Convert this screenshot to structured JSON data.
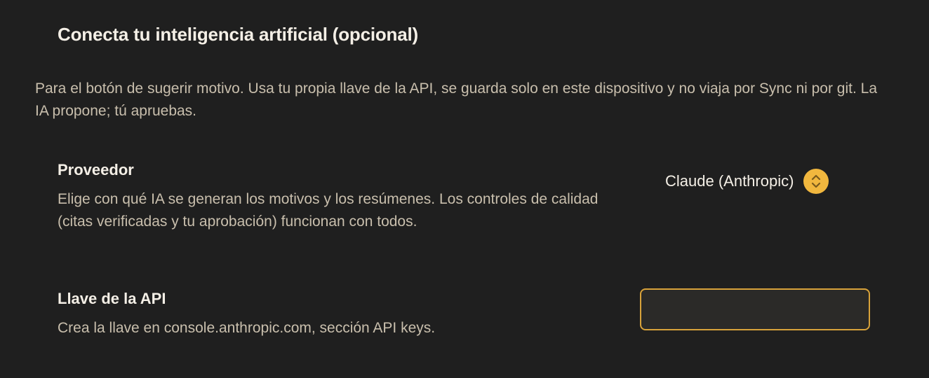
{
  "section": {
    "title": "Conecta tu inteligencia artificial (opcional)",
    "intro": "Para el botón de sugerir motivo. Usa tu propia llave de la API, se guarda solo en este dispositivo y no viaja por Sync ni por git. La IA propone; tú apruebas."
  },
  "provider": {
    "title": "Proveedor",
    "description": "Elige con qué IA se generan los motivos y los resúmenes. Los controles de calidad (citas verificadas y tu aprobación) funcionan con todos.",
    "selected": "Claude (Anthropic)",
    "icon": "chevron-up-down-icon"
  },
  "api_key": {
    "title": "Llave de la API",
    "description": "Crea la llave en console.anthropic.com, sección API keys.",
    "value": ""
  },
  "colors": {
    "background": "#1f1f1f",
    "accent": "#f1b73e",
    "input_border": "#d8a23a",
    "primary_text": "#f4efe6",
    "secondary_text": "#c9bfad"
  }
}
